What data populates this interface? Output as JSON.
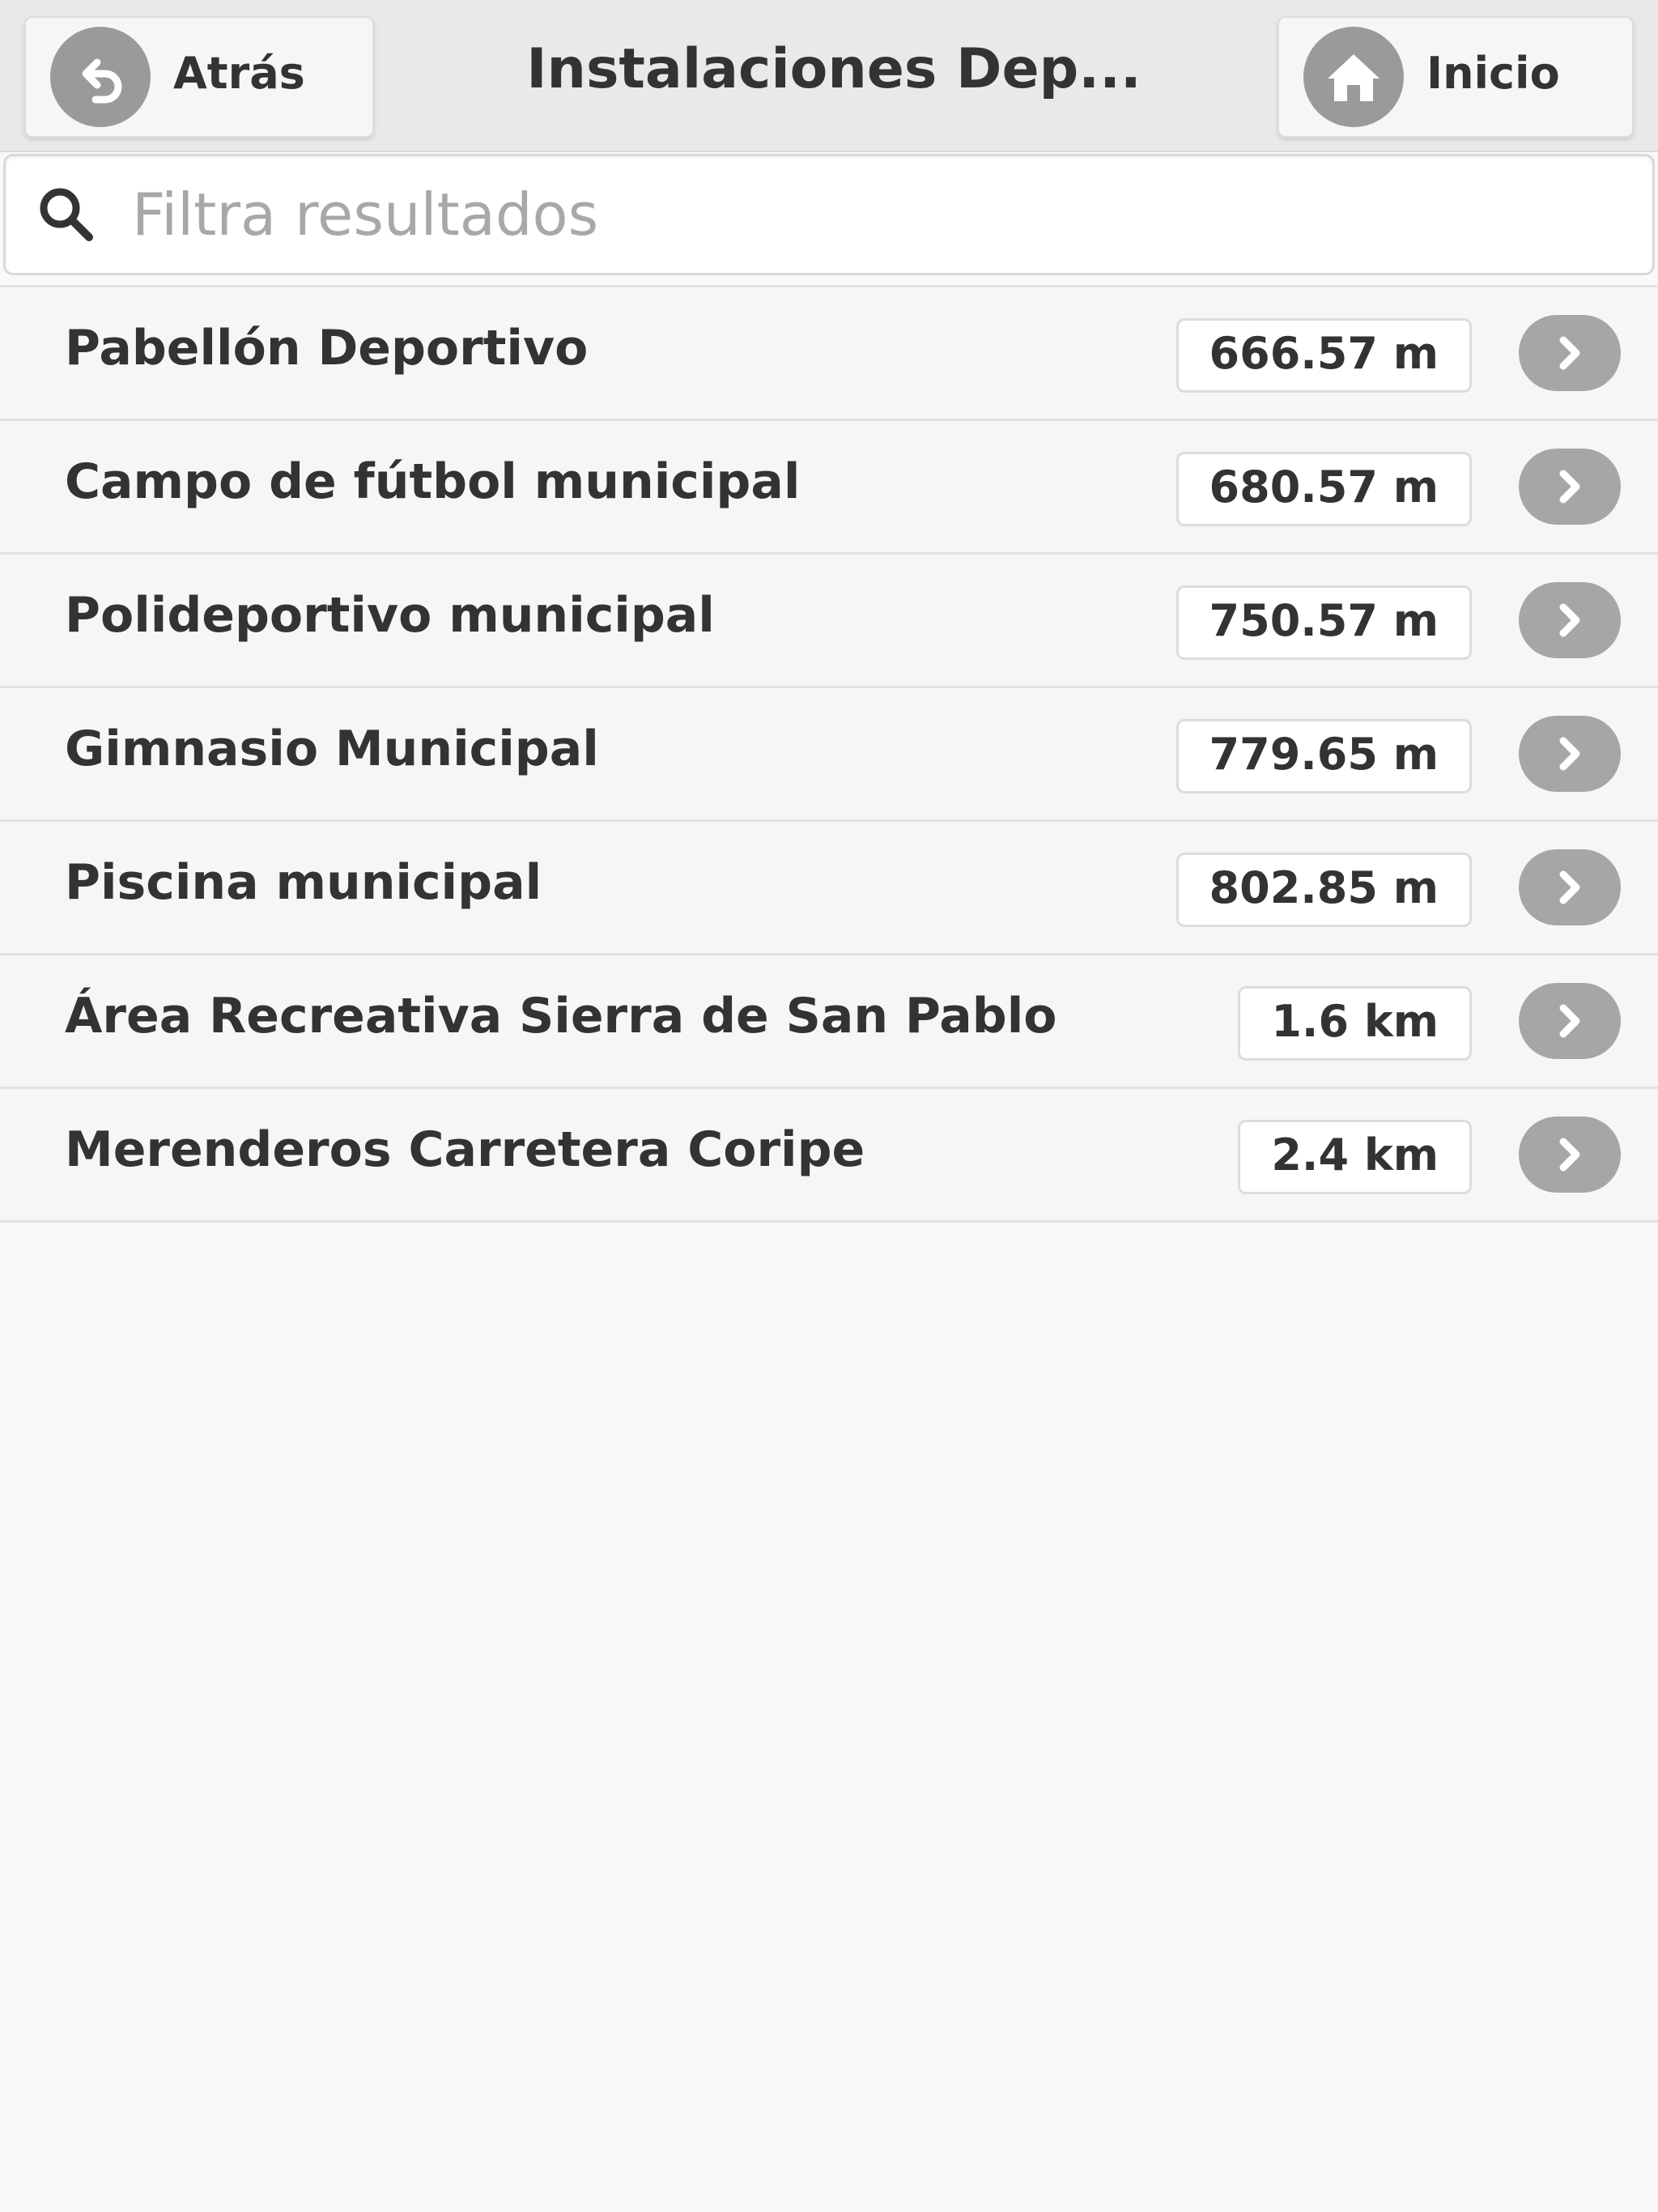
{
  "header": {
    "back_label": "Atrás",
    "title": "Instalaciones Dep...",
    "home_label": "Inicio",
    "back_icon": "back-arrow-icon",
    "home_icon": "home-icon"
  },
  "search": {
    "placeholder": "Filtra resultados",
    "value": "",
    "icon": "search-icon"
  },
  "items": [
    {
      "label": "Pabellón Deportivo",
      "distance": "666.57 m"
    },
    {
      "label": "Campo de fútbol municipal",
      "distance": "680.57 m"
    },
    {
      "label": "Polideportivo municipal",
      "distance": "750.57 m"
    },
    {
      "label": "Gimnasio Municipal",
      "distance": "779.65 m"
    },
    {
      "label": "Piscina municipal",
      "distance": "802.85 m"
    },
    {
      "label": "Área Recreativa Sierra de San Pablo",
      "distance": "1.6 km"
    },
    {
      "label": "Merenderos Carretera Coripe",
      "distance": "2.4 km"
    }
  ],
  "colors": {
    "header_bg": "#e9e9e9",
    "icon_gray": "#a6a6a6",
    "text": "#333333",
    "placeholder": "#a8a8a8"
  }
}
